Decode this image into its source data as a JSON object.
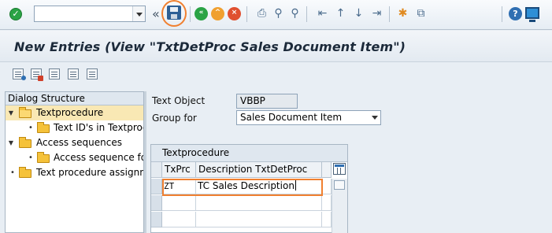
{
  "toolbar": {
    "command_field_value": "",
    "chevron": "«",
    "icons": [
      "enter-icon",
      "save-icon",
      "back-icon",
      "exit-icon",
      "cancel-icon",
      "print-icon",
      "find-icon",
      "find-next-icon",
      "first-page-icon",
      "previous-page-icon",
      "next-page-icon",
      "last-page-icon",
      "new-session-icon",
      "shortcut-icon",
      "help-icon",
      "customize-layout-icon"
    ],
    "check_glyph": "✓",
    "help_glyph": "?"
  },
  "title": "New Entries (View \"TxtDetProc Sales Document Item\")",
  "dialog_structure": {
    "header": "Dialog Structure",
    "items": [
      {
        "label": "Textprocedure",
        "level": 0,
        "expanded": true,
        "selected": true
      },
      {
        "label": "Text ID's in Textproc",
        "level": 1
      },
      {
        "label": "Access sequences",
        "level": 0,
        "expanded": true
      },
      {
        "label": "Access sequence for",
        "level": 1
      },
      {
        "label": "Text procedure assignm",
        "level": 0
      }
    ]
  },
  "form": {
    "text_object_label": "Text Object",
    "text_object_value": "VBBP",
    "group_for_label": "Group for",
    "group_for_value": "Sales Document Item"
  },
  "table": {
    "title": "Textprocedure",
    "columns": [
      "TxPrc",
      "Description TxtDetProc"
    ],
    "rows": [
      {
        "txprc": "ZT",
        "description": "TC Sales Description"
      },
      {
        "txprc": "",
        "description": ""
      },
      {
        "txprc": "",
        "description": ""
      }
    ]
  },
  "colors": {
    "highlight": "#f08030",
    "selected_row": "#f9e8b4",
    "title_text": "#1c2a3a"
  }
}
